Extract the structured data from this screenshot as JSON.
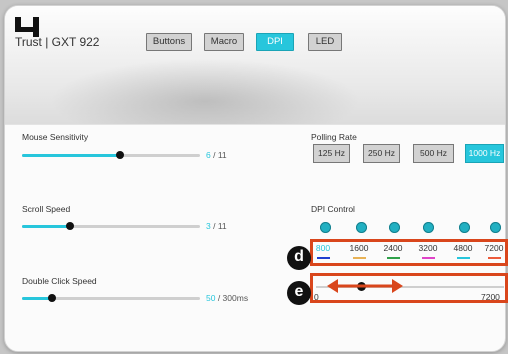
{
  "app": {
    "title": "Trust | GXT 922",
    "logo_mark": "4",
    "tabs": [
      {
        "label": "Buttons",
        "active": false
      },
      {
        "label": "Macro",
        "active": false
      },
      {
        "label": "DPI",
        "active": true
      },
      {
        "label": "LED",
        "active": false
      }
    ]
  },
  "sliders": {
    "mouse_sensitivity": {
      "label": "Mouse Sensitivity",
      "value": "6",
      "max_text": " / 11",
      "fraction": 0.55
    },
    "scroll_speed": {
      "label": "Scroll Speed",
      "value": "3",
      "max_text": " / 11",
      "fraction": 0.27
    },
    "double_click_speed": {
      "label": "Double Click Speed",
      "value": "50",
      "max_text": " / 300ms",
      "fraction": 0.17
    }
  },
  "polling_rate": {
    "label": "Polling Rate",
    "options": [
      {
        "label": "125 Hz",
        "active": false
      },
      {
        "label": "250 Hz",
        "active": false
      },
      {
        "label": "500 Hz",
        "active": false
      },
      {
        "label": "1000 Hz",
        "active": true
      }
    ]
  },
  "dpi_control": {
    "label": "DPI Control",
    "levels": [
      {
        "value": "800",
        "color": "#1f3fcf"
      },
      {
        "value": "1600",
        "color": "#e8b255"
      },
      {
        "value": "2400",
        "color": "#2fa14a"
      },
      {
        "value": "3200",
        "color": "#e043c8"
      },
      {
        "value": "4800",
        "color": "#27c6dc"
      },
      {
        "value": "7200",
        "color": "#ec5a3a"
      }
    ],
    "range": {
      "min_label": "0",
      "max_label": "7200",
      "knob_value": 800,
      "max_value": 7200
    }
  },
  "annotations": {
    "marker_d": "d",
    "marker_e": "e",
    "color": "#d9461c"
  },
  "colors": {
    "accent": "#27c6dc",
    "knob": "#111111"
  }
}
